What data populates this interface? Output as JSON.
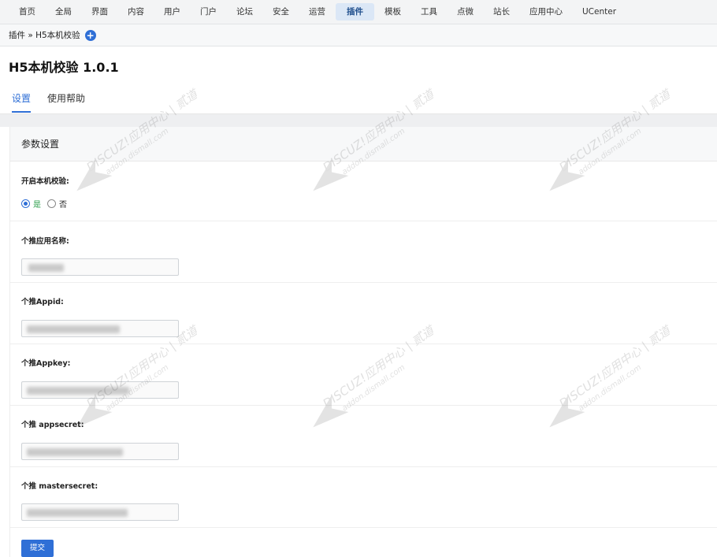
{
  "topnav": {
    "items": [
      "首页",
      "全局",
      "界面",
      "内容",
      "用户",
      "门户",
      "论坛",
      "安全",
      "运营",
      "插件",
      "模板",
      "工具",
      "点微",
      "站长",
      "应用中心",
      "UCenter"
    ],
    "active_index": 9
  },
  "breadcrumb": {
    "text": "插件 » H5本机校验",
    "plus_label": "+"
  },
  "page": {
    "title": "H5本机校验 1.0.1"
  },
  "tabs": [
    {
      "label": "设置",
      "active": true
    },
    {
      "label": "使用帮助",
      "active": false
    }
  ],
  "panel": {
    "header": "参数设置",
    "fields": {
      "enable": {
        "label": "开启本机校验:",
        "options": [
          "是",
          "否"
        ],
        "selected": "是"
      },
      "app_name": {
        "label": "个推应用名称:",
        "value": ""
      },
      "appid": {
        "label": "个推Appid:",
        "value": ""
      },
      "appkey": {
        "label": "个推Appkey:",
        "value": ""
      },
      "appsecret": {
        "label": "个推 appsecret:",
        "value": ""
      },
      "mastersecret": {
        "label": "个推 mastersecret:",
        "value": ""
      }
    },
    "submit_label": "提交"
  },
  "watermark": {
    "text": "DISCUZ!应用中心 | 贰道",
    "subtext": "addon.dismall.com"
  },
  "colors": {
    "accent": "#2f6fd6",
    "active_tab_bg": "#dbe7f6",
    "radio_on_text": "#2a9d4a"
  }
}
